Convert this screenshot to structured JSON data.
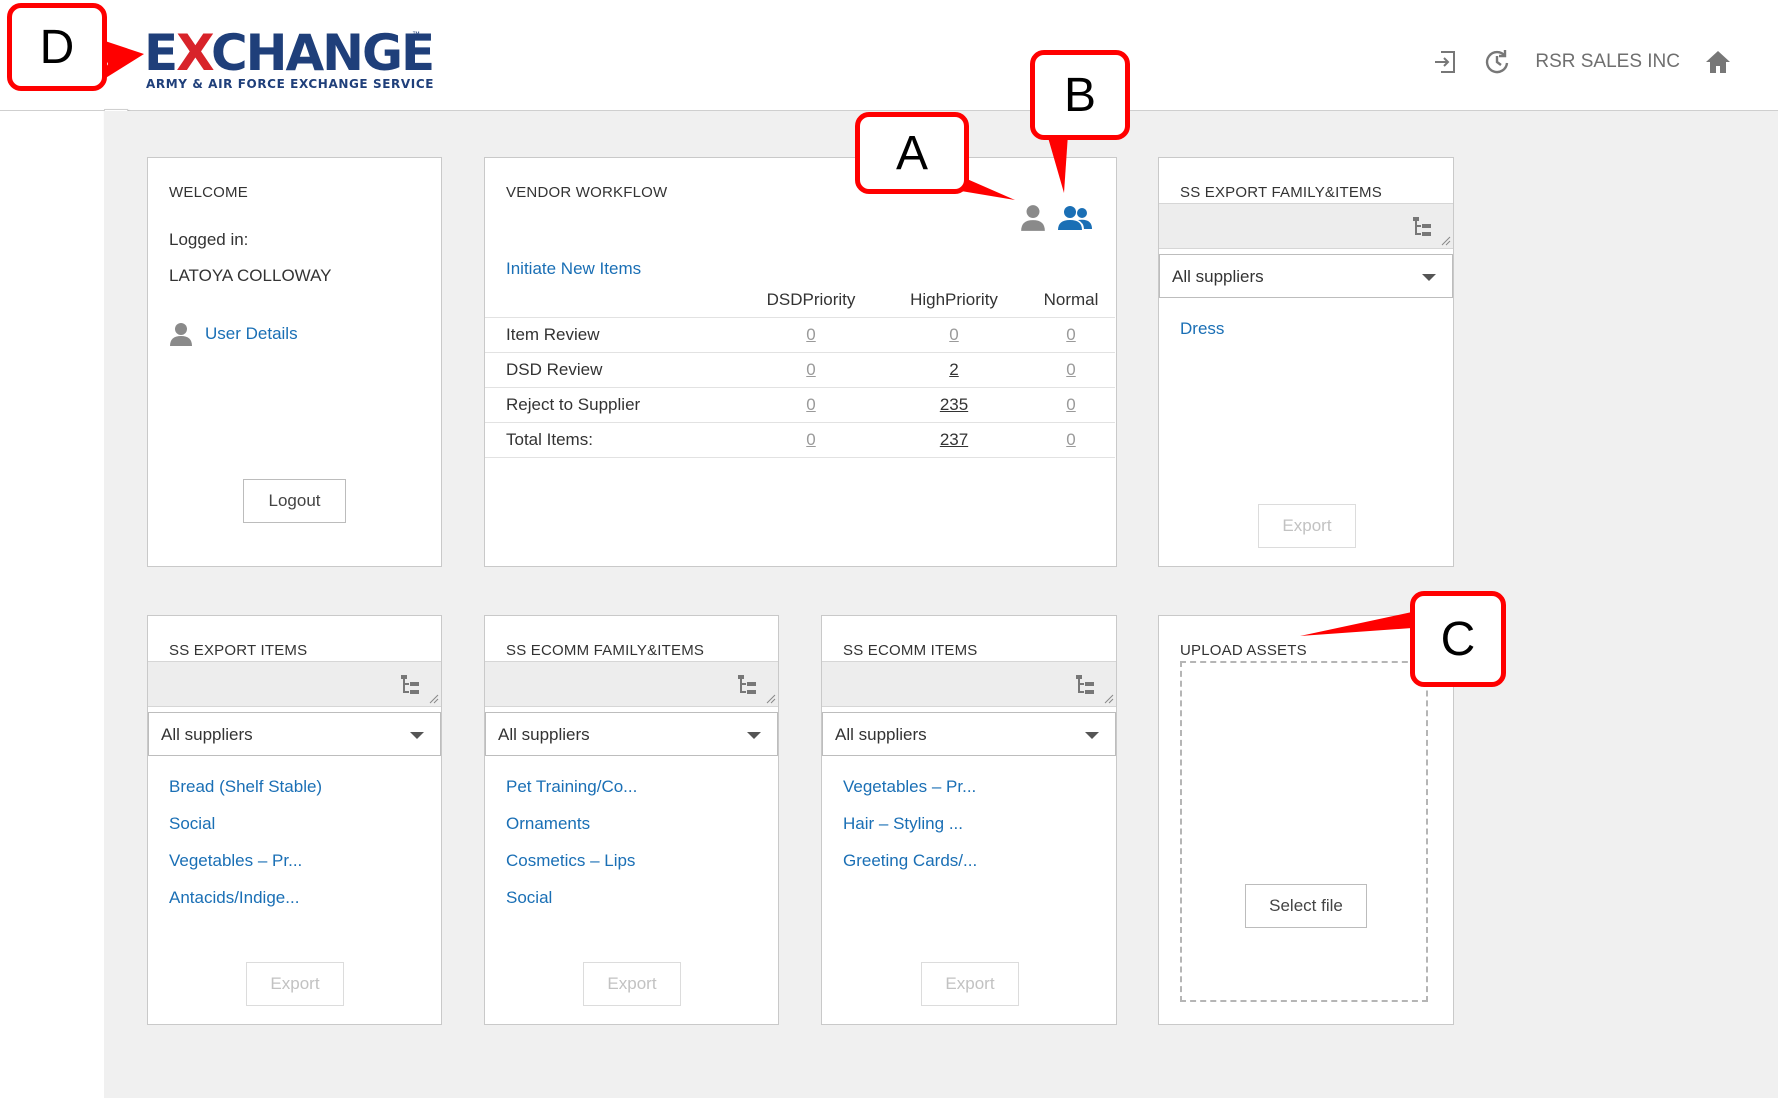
{
  "header": {
    "logo_main_a": "E",
    "logo_main_x": "X",
    "logo_main_b": "CHANGE",
    "logo_tm": "™",
    "logo_sub": "ARMY & AIR FORCE EXCHANGE SERVICE",
    "company": "RSR SALES INC"
  },
  "welcome": {
    "title": "WELCOME",
    "logged_in_label": "Logged in:",
    "user_name": "LATOYA COLLOWAY",
    "user_details_link": "User Details",
    "logout_button": "Logout"
  },
  "vendor_workflow": {
    "title": "VENDOR WORKFLOW",
    "initiate_link": "Initiate New Items",
    "columns": [
      "DSDPriority",
      "HighPriority",
      "Normal"
    ],
    "rows": [
      {
        "label": "Item Review",
        "values": [
          "0",
          "0",
          "0"
        ]
      },
      {
        "label": "DSD Review",
        "values": [
          "0",
          "2",
          "0"
        ]
      },
      {
        "label": "Reject to Supplier",
        "values": [
          "0",
          "235",
          "0"
        ]
      },
      {
        "label": "Total Items:",
        "values": [
          "0",
          "237",
          "0"
        ]
      }
    ]
  },
  "ss_export_family_items": {
    "title": "SS EXPORT FAMILY&ITEMS",
    "supplier_select": "All suppliers",
    "links": [
      "Dress"
    ],
    "export_button": "Export"
  },
  "ss_export_items": {
    "title": "SS EXPORT ITEMS",
    "supplier_select": "All suppliers",
    "links": [
      "Bread (Shelf Stable)",
      "Social",
      "Vegetables – Pr...",
      "Antacids/Indige..."
    ],
    "export_button": "Export"
  },
  "ss_ecomm_family_items": {
    "title": "SS ECOMM FAMILY&ITEMS",
    "supplier_select": "All suppliers",
    "links": [
      "Pet Training/Co...",
      "Ornaments",
      "Cosmetics – Lips",
      "Social"
    ],
    "export_button": "Export"
  },
  "ss_ecomm_items": {
    "title": "SS ECOMM ITEMS",
    "supplier_select": "All suppliers",
    "links": [
      "Vegetables – Pr...",
      "Hair – Styling ...",
      "Greeting Cards/..."
    ],
    "export_button": "Export"
  },
  "upload_assets": {
    "title": "UPLOAD ASSETS",
    "select_file_button": "Select file"
  },
  "annotations": {
    "a": "A",
    "b": "B",
    "c": "C",
    "d": "D"
  },
  "colors": {
    "link": "#1a6fb5",
    "annotation": "#ff0000",
    "brand_blue": "#1f3f7a",
    "brand_red": "#d8232a"
  }
}
